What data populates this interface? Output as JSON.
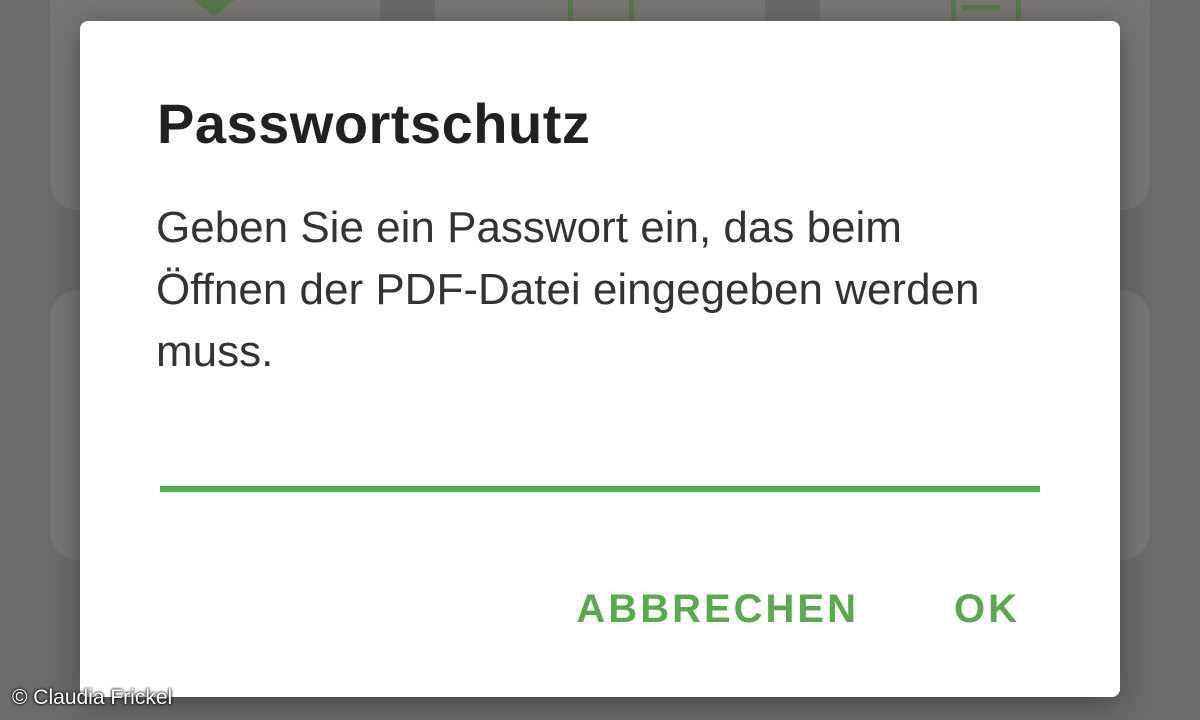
{
  "dialog": {
    "title": "Passwortschutz",
    "message": "Geben Sie ein Passwort ein, das beim Öffnen der PDF-Datei eingegeben werden muss.",
    "password_value": "",
    "buttons": {
      "cancel": "ABBRECHEN",
      "ok": "OK"
    }
  },
  "background_icons": [
    "mail-icon",
    "file-icon",
    "print-icon"
  ],
  "image_credit": "© Claudia Frickel",
  "colors": {
    "accent": "#5aa94f",
    "input_underline": "#4caf50",
    "scrim": "#6e6a66",
    "dialog_bg": "#ffffff",
    "title_text": "#212121"
  }
}
